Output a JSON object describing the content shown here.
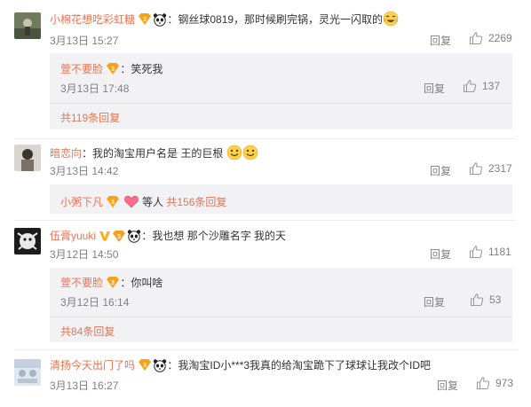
{
  "comments": [
    {
      "user": "小棉花想吃彩虹糖",
      "text": "：钢丝球0819，那时候刷完锅，灵光一闪取的",
      "time": "3月13日 15:27",
      "reply_label": "回复",
      "likes": "2269",
      "subreplies": [
        {
          "user": "萱不要脸",
          "text": "：笑死我",
          "time": "3月13日 17:48",
          "reply_label": "回复",
          "likes": "137"
        }
      ],
      "more": "共119条回复"
    },
    {
      "user": "暗恋向",
      "text": "：我的淘宝用户名是 王的巨根",
      "time": "3月13日 14:42",
      "reply_label": "回复",
      "likes": "2317",
      "preview_user": "小粥下凡",
      "preview_text": "等人",
      "more": "共156条回复"
    },
    {
      "user": "伍膏yuuki",
      "text": "：我也想 那个沙雕名字 我的天",
      "time": "3月12日 14:50",
      "reply_label": "回复",
      "likes": "1181",
      "subreplies": [
        {
          "user": "萱不要脸",
          "text": "：你叫啥",
          "time": "3月12日 16:14",
          "reply_label": "回复",
          "likes": "53"
        }
      ],
      "more": "共84条回复"
    },
    {
      "user": "清扬今天出门了吗",
      "text": "：我淘宝ID小***3我真的给淘宝跪下了球球让我改个ID吧",
      "time": "3月13日 16:27",
      "reply_label": "回复",
      "likes": "973"
    }
  ],
  "colors": {
    "username": "#eb7350",
    "meta": "#808080",
    "subbox_bg": "#f2f2f5",
    "badge": "#f7a01a"
  },
  "icons": [
    "thumbs-up-icon",
    "vip-badge-icon",
    "panda-icon",
    "crying-laugh-emoji",
    "grin-emoji",
    "heart-emoji",
    "gold-v-icon"
  ]
}
